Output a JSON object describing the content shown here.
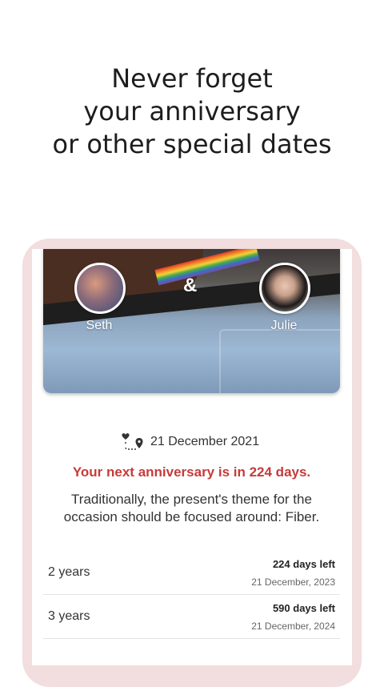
{
  "headline": [
    "Never forget",
    "your anniversary",
    "or other special dates"
  ],
  "couple": {
    "person1": "Seth",
    "person2": "Julie",
    "separator": "&"
  },
  "start_date": "21 December 2021",
  "next_anniversary": "Your next anniversary is in 224 days.",
  "theme_text": "Traditionally, the present's theme for the occasion should be focused around: Fiber.",
  "anniversaries": [
    {
      "years": "2 years",
      "days_left": "224 days left",
      "date": "21 December, 2023"
    },
    {
      "years": "3 years",
      "days_left": "590 days left",
      "date": "21 December, 2024"
    }
  ],
  "colors": {
    "accent_red": "#c73a3a",
    "frame_pink": "#f2dede"
  },
  "icons": {
    "date": "heart-path-pin-icon"
  }
}
